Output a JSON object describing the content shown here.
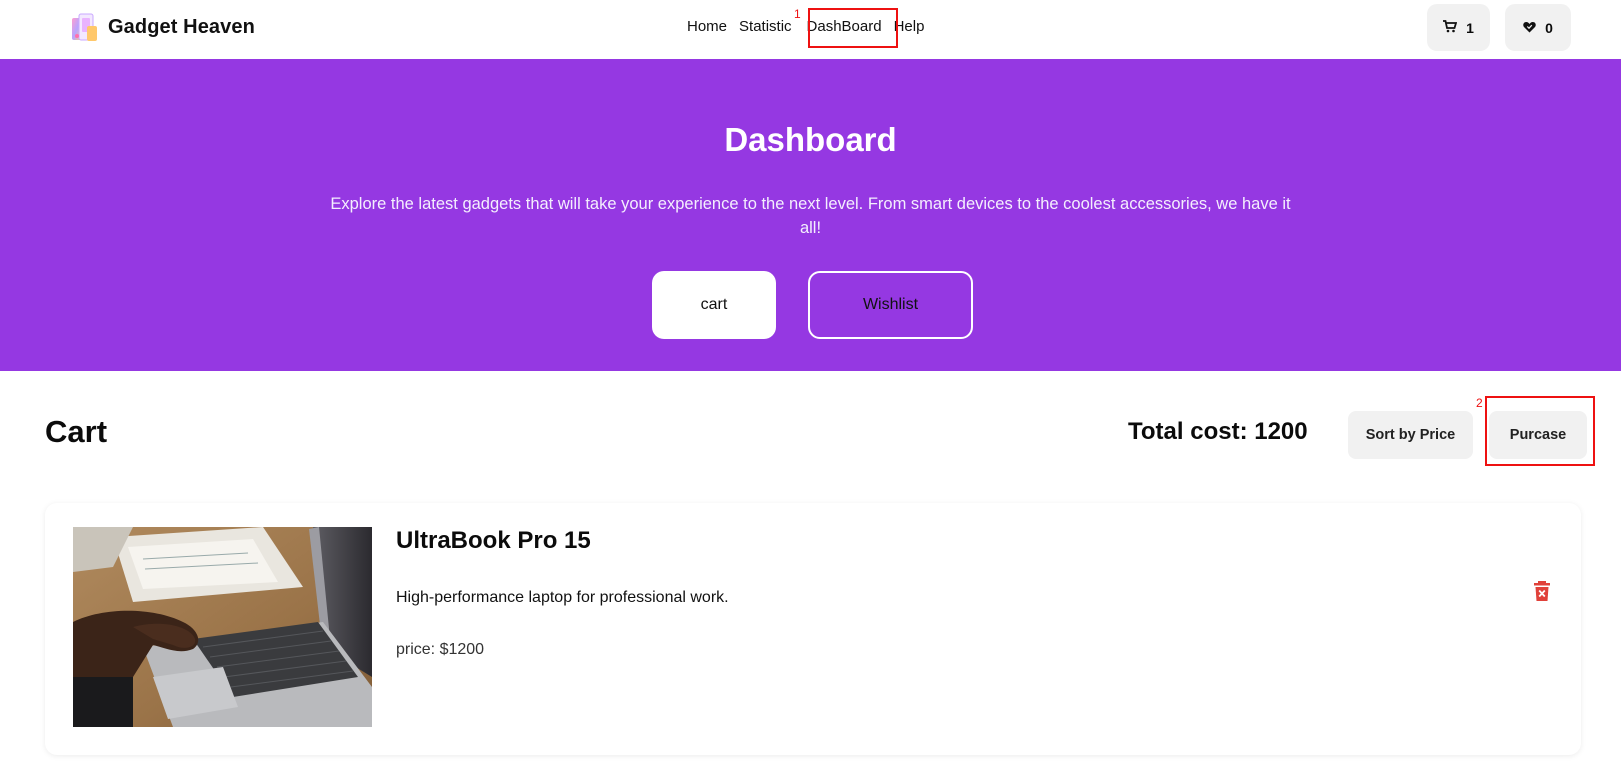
{
  "brand": {
    "name": "Gadget Heaven",
    "accent": "#9538e2"
  },
  "nav": {
    "links": [
      "Home",
      "Statistic",
      "DashBoard",
      "Help"
    ],
    "cart_count": "1",
    "wishlist_count": "0"
  },
  "annotations": {
    "first": "1",
    "second": "2"
  },
  "hero": {
    "title": "Dashboard",
    "subtitle": "Explore the latest gadgets that will take your experience to the next level. From smart devices to the coolest accessories, we have it all!",
    "cart_button": "cart",
    "wishlist_button": "Wishlist"
  },
  "cart": {
    "title": "Cart",
    "total_cost": "Total cost: 1200",
    "sort_button": "Sort by Price",
    "purchase_button": "Purcase"
  },
  "items": [
    {
      "name": "UltraBook Pro 15",
      "description": "High-performance laptop for professional work.",
      "price": "price: $1200",
      "image_icon": "laptop-photo"
    }
  ],
  "colors": {
    "delete": "#e0413a",
    "annotation": "#ee1111",
    "button_bg": "#f1f1f1"
  }
}
